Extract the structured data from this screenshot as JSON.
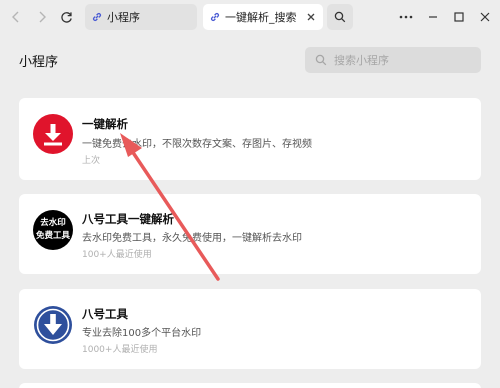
{
  "tabs": [
    {
      "label": "小程序",
      "icon": "link-icon"
    },
    {
      "label": "一键解析_搜索",
      "icon": "link-icon"
    }
  ],
  "main": {
    "title": "小程序",
    "search_placeholder": "搜索小程序"
  },
  "apps": [
    {
      "name": "一键解析",
      "desc": "一键免费去水印，不限次数存文案、存图片、存视频",
      "meta": "上次",
      "icon_color": "#e0142c"
    },
    {
      "name": "八号工具一键解析",
      "desc": "去水印免费工具，永久免费使用，一键解析去水印",
      "meta": "100+人最近使用",
      "icon_text_line1": "去水印",
      "icon_text_line2": "免费工具",
      "icon_color": "#000000"
    },
    {
      "name": "八号工具",
      "desc": "专业去除100多个平台水印",
      "meta": "1000+人最近使用",
      "icon_color": "#2e4f9c"
    }
  ],
  "colors": {
    "annotation_arrow": "#e85a5a",
    "accent": "#4a5bd4"
  }
}
